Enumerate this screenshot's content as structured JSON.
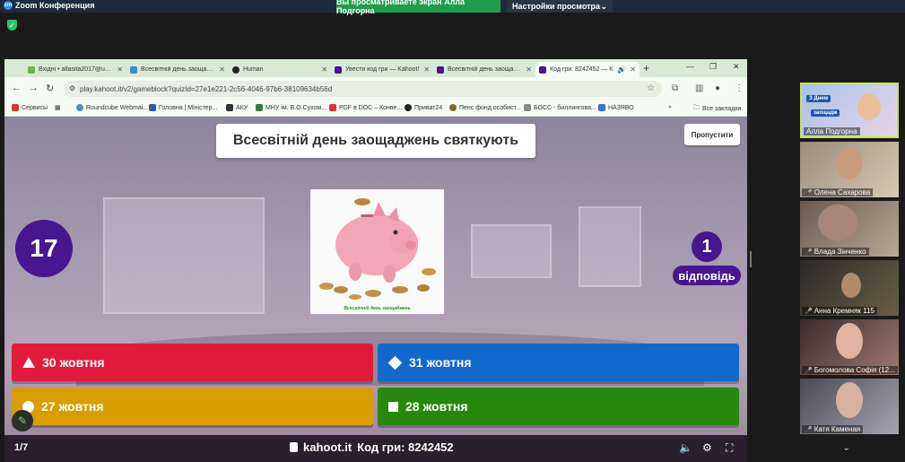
{
  "zoom": {
    "title": "Zoom Конференция",
    "logo": "zm",
    "share_banner": "Вы просматриваете экран Алла Подгорна",
    "view_settings": "Настройки просмотра"
  },
  "browser": {
    "tabs": [
      {
        "label": "Вхідні • allasita2017@ukr.n",
        "color": "#6fb34a"
      },
      {
        "label": "Всесвітній день заощадже",
        "color": "#3a86d6"
      },
      {
        "label": "Human",
        "color": "#222222"
      },
      {
        "label": "Увести код гри — Kahoot!",
        "color": "#46178f"
      },
      {
        "label": "Всесвітній день заощадже",
        "color": "#46178f"
      },
      {
        "label": "Код гри: 8242452 — К",
        "color": "#46178f"
      }
    ],
    "url": "play.kahoot.it/v2/gameblock?quizId=27e1e221-2c56-4046-97b6-38109634b56d",
    "bookmarks": [
      "Сервисы",
      "Roundcube Webmai...",
      "Головна | Міністер...",
      "АКУ",
      "МНУ ім. В.О.Сухом...",
      "PDF в DOC – Конве...",
      "Приват24",
      "Пенс фонд особист...",
      "БОСС - биллингова...",
      "НАЗЯВО"
    ],
    "all_bookmarks": "Все закладки"
  },
  "game": {
    "question": "Всесвітній день заощаджень святкують",
    "skip_label": "Пропустити",
    "timer": "17",
    "answers_count": "1",
    "answers_word": "відповідь",
    "image_caption": "Всесвітній день заощаджень",
    "answers": [
      {
        "text": "30 жовтня",
        "shape": "triangle",
        "color": "#e21b3c"
      },
      {
        "text": "31 жовтня",
        "shape": "diamond",
        "color": "#1368ce"
      },
      {
        "text": "27 жовтня",
        "shape": "circle",
        "color": "#d89e00"
      },
      {
        "text": "28 жовтня",
        "shape": "square",
        "color": "#26890c"
      }
    ],
    "progress": "1/7",
    "pin_site": "kahoot.it",
    "pin_label": "Код гри: 8242452"
  },
  "gallery": {
    "participants": [
      {
        "name": "Алла Подгорна",
        "muted": false,
        "speaking": true
      },
      {
        "name": "Олена Сахарова",
        "muted": true
      },
      {
        "name": "Влада Зінченко",
        "muted": true
      },
      {
        "name": "Анна Кремняк 115",
        "muted": true
      },
      {
        "name": "Богомолова Софія (12...",
        "muted": true
      },
      {
        "name": "Катя Каменая",
        "muted": true
      }
    ],
    "first_tile_badge_1": "З Днем",
    "first_tile_badge_2": "заощадж"
  }
}
